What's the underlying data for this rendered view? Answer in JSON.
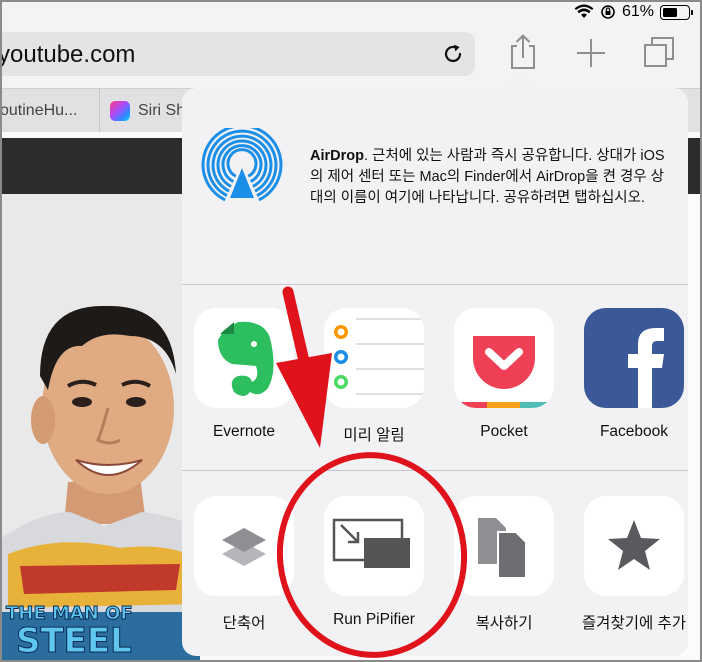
{
  "status": {
    "battery": "61%",
    "battery_level": 0.61
  },
  "address_bar": {
    "url": "youtube.com"
  },
  "toolbar": {
    "share_icon": "share-icon",
    "new_tab_icon": "plus-icon",
    "tabs_icon": "tabs-icon",
    "reload_icon": "reload-icon"
  },
  "tabs": [
    {
      "label": "outineHu..."
    },
    {
      "label": "Siri Sh"
    }
  ],
  "airdrop": {
    "title": "AirDrop",
    "description": ". 근처에 있는 사람과 즉시 공유합니다. 상대가 iOS의 제어 센터 또는 Mac의 Finder에서 AirDrop을 켠 경우 상대의 이름이 여기에 나타납니다. 공유하려면 탭하십시오."
  },
  "share_apps": [
    {
      "label": "Evernote",
      "icon": "evernote-icon"
    },
    {
      "label": "미리 알림",
      "icon": "reminders-icon"
    },
    {
      "label": "Pocket",
      "icon": "pocket-icon"
    },
    {
      "label": "Facebook",
      "icon": "facebook-icon"
    }
  ],
  "actions": [
    {
      "label": "단축어",
      "icon": "shortcuts-icon"
    },
    {
      "label": "Run PiPifier",
      "icon": "pipifier-icon"
    },
    {
      "label": "복사하기",
      "icon": "copy-icon"
    },
    {
      "label": "즐겨찾기에 추가",
      "icon": "star-icon"
    }
  ],
  "photo_shirt_text": [
    "THE MAN OF",
    "STEEL"
  ],
  "colors": {
    "annotation_red": "#e0121b",
    "airdrop_blue": "#1b8ee8",
    "evernote_green": "#2dbe60",
    "pocket_red": "#ef4056",
    "facebook_blue": "#3b5998"
  }
}
